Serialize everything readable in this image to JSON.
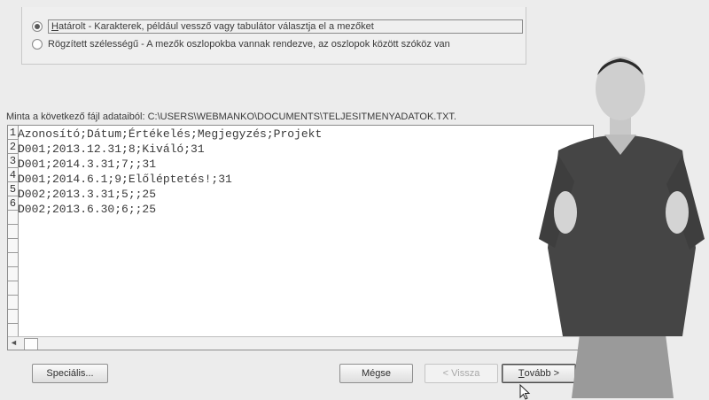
{
  "options": {
    "delimited": {
      "label_accel": "H",
      "label_rest": "atárolt - Karakterek, például vessző vagy tabulátor választja el a mezőket",
      "selected": true
    },
    "fixed_width": {
      "label_start": "Rögzített szélessé",
      "label_accel": "g",
      "label_rest": "ű - A mezők oszlopokba vannak rendezve, az oszlopok között szóköz van",
      "selected": false
    }
  },
  "preview": {
    "caption": "Minta a következő fájl adataiból: C:\\USERS\\WEBMANKO\\DOCUMENTS\\TELJESITMENYADATOK.TXT.",
    "line_numbers": [
      "1",
      "2",
      "3",
      "4",
      "5",
      "6"
    ],
    "lines": [
      "Azonosító;Dátum;Értékelés;Megjegyzés;Projekt",
      "D001;2013.12.31;8;Kiváló;31",
      "D001;2014.3.31;7;;31",
      "D001;2014.6.1;9;Előléptetés!;31",
      "D002;2013.3.31;5;;25",
      "D002;2013.6.30;6;;25"
    ]
  },
  "buttons": {
    "advanced": "Speciális...",
    "cancel": "Mégse",
    "back": "< Vissza",
    "next_accel": "T",
    "next_rest": "ovább >"
  }
}
